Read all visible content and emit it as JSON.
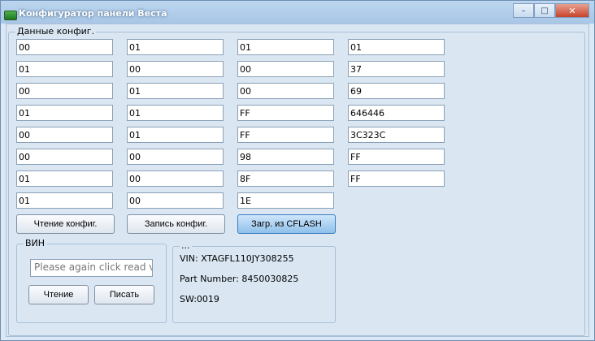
{
  "window": {
    "title": "Конфигуратор панели Веста"
  },
  "config_group": {
    "label": "Данные конфиг."
  },
  "fields": {
    "c1": [
      "00",
      "01",
      "00",
      "01",
      "00",
      "00",
      "01",
      "01"
    ],
    "c2": [
      "01",
      "00",
      "01",
      "01",
      "01",
      "00",
      "00",
      "00"
    ],
    "c3": [
      "01",
      "00",
      "00",
      "FF",
      "FF",
      "98",
      "8F",
      "1E"
    ],
    "c4": [
      "01",
      "37",
      "69",
      "646446",
      "3C323C",
      "FF",
      "FF"
    ]
  },
  "buttons": {
    "read_config": "Чтение конфиг.",
    "write_config": "Запись конфиг.",
    "load_cflash": "Загр. из CFLASH"
  },
  "vin_group": {
    "label": "ВИН",
    "input_value": "Please again click read vin",
    "read_button": "Чтение",
    "write_button": "Писать"
  },
  "info_group": {
    "label": "...",
    "vin": "VIN: XTAGFL110JY308255",
    "part_number": "Part Number: 8450030825",
    "sw": "SW:0019"
  }
}
